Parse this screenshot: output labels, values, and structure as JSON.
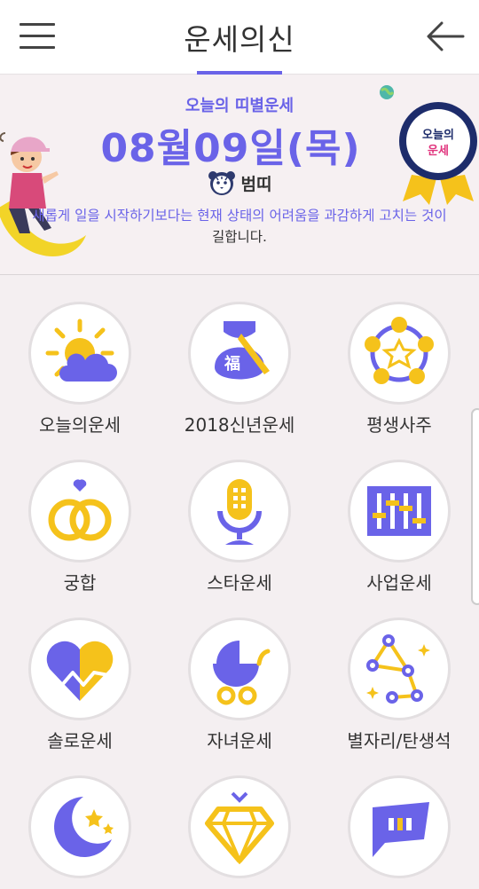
{
  "header": {
    "title": "운세의신",
    "menu_icon": "hamburger-menu-icon",
    "back_icon": "back-arrow-icon"
  },
  "banner": {
    "subtitle": "오늘의 띠별운세",
    "date": "08월09일(목)",
    "zodiac_label": "범띠",
    "fortune_line1": "새롭게 일을 시작하기보다는 현재 상태의 어려움을 과감하게 고치는 것이",
    "fortune_line2": "길합니다.",
    "badge_line1": "오늘의",
    "badge_line2": "운세"
  },
  "menu": {
    "items": [
      {
        "label": "오늘의운세",
        "icon": "sun-cloud-icon"
      },
      {
        "label": "2018신년운세",
        "icon": "fortune-bag-icon"
      },
      {
        "label": "평생사주",
        "icon": "star-circle-icon"
      },
      {
        "label": "궁합",
        "icon": "rings-icon"
      },
      {
        "label": "스타운세",
        "icon": "microphone-icon"
      },
      {
        "label": "사업운세",
        "icon": "equalizer-icon"
      },
      {
        "label": "솔로운세",
        "icon": "broken-heart-icon"
      },
      {
        "label": "자녀운세",
        "icon": "baby-carriage-icon"
      },
      {
        "label": "별자리/탄생석",
        "icon": "constellation-icon"
      },
      {
        "label": "",
        "icon": "moon-stars-icon"
      },
      {
        "label": "",
        "icon": "diamond-icon"
      },
      {
        "label": "",
        "icon": "chat-bubble-icon"
      }
    ]
  },
  "colors": {
    "accent": "#6a63e8",
    "yellow": "#f5c21b",
    "background": "#f4eff1",
    "badge_navy": "#1d2c6b",
    "badge_pink": "#e0337c"
  }
}
